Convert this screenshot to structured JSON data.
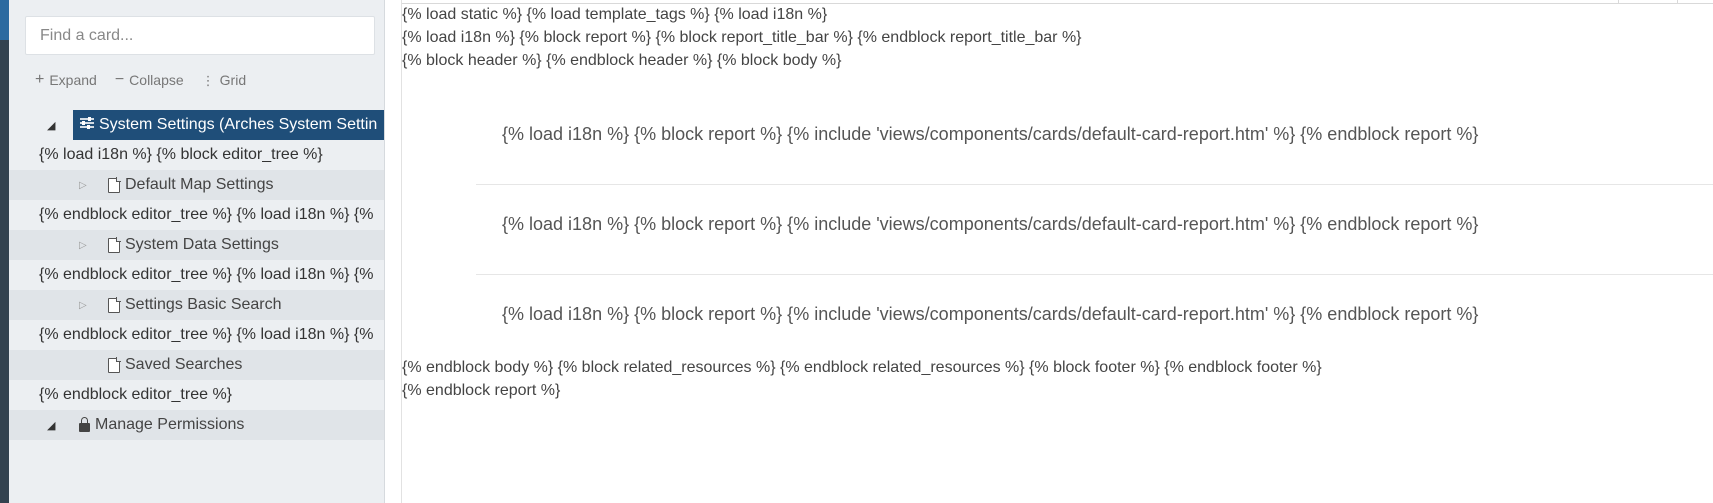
{
  "search": {
    "placeholder": "Find a card..."
  },
  "toolbar": {
    "expand": "Expand",
    "collapse": "Collapse",
    "grid": "Grid"
  },
  "tree": {
    "selected_label": "System Settings (Arches System Settin",
    "template_lines": [
      "{% load i18n %} {% block editor_tree %}",
      "{% endblock editor_tree %} {% load i18n %} {%",
      "{% endblock editor_tree %} {% load i18n %} {%",
      "{% endblock editor_tree %} {% load i18n %} {%",
      "{% endblock editor_tree %}"
    ],
    "nodes": [
      {
        "label": "Default Map Settings"
      },
      {
        "label": "System Data Settings"
      },
      {
        "label": "Settings Basic Search"
      },
      {
        "label": "Saved Searches"
      }
    ],
    "permissions_label": "Manage Permissions"
  },
  "main": {
    "header_lines": [
      "{% load static %} {% load template_tags %} {% load i18n %}",
      "{% load i18n %} {% block report %} {% block report_title_bar %} {% endblock report_title_bar %}",
      "{% block header %} {% endblock header %} {% block body %}"
    ],
    "card_lines": [
      "{% load i18n %} {% block report %} {% include 'views/components/cards/default-card-report.htm' %} {% endblock report %}",
      "{% load i18n %} {% block report %} {% include 'views/components/cards/default-card-report.htm' %} {% endblock report %}",
      "{% load i18n %} {% block report %} {% include 'views/components/cards/default-card-report.htm' %} {% endblock report %}"
    ],
    "footer_lines": [
      "{% endblock body %} {% block related_resources %} {% endblock related_resources %} {% block footer %} {% endblock footer %}",
      "{% endblock report %}"
    ]
  },
  "colors": {
    "selected_bg": "#1f4e79",
    "sidebar_bg": "#eceff2"
  }
}
